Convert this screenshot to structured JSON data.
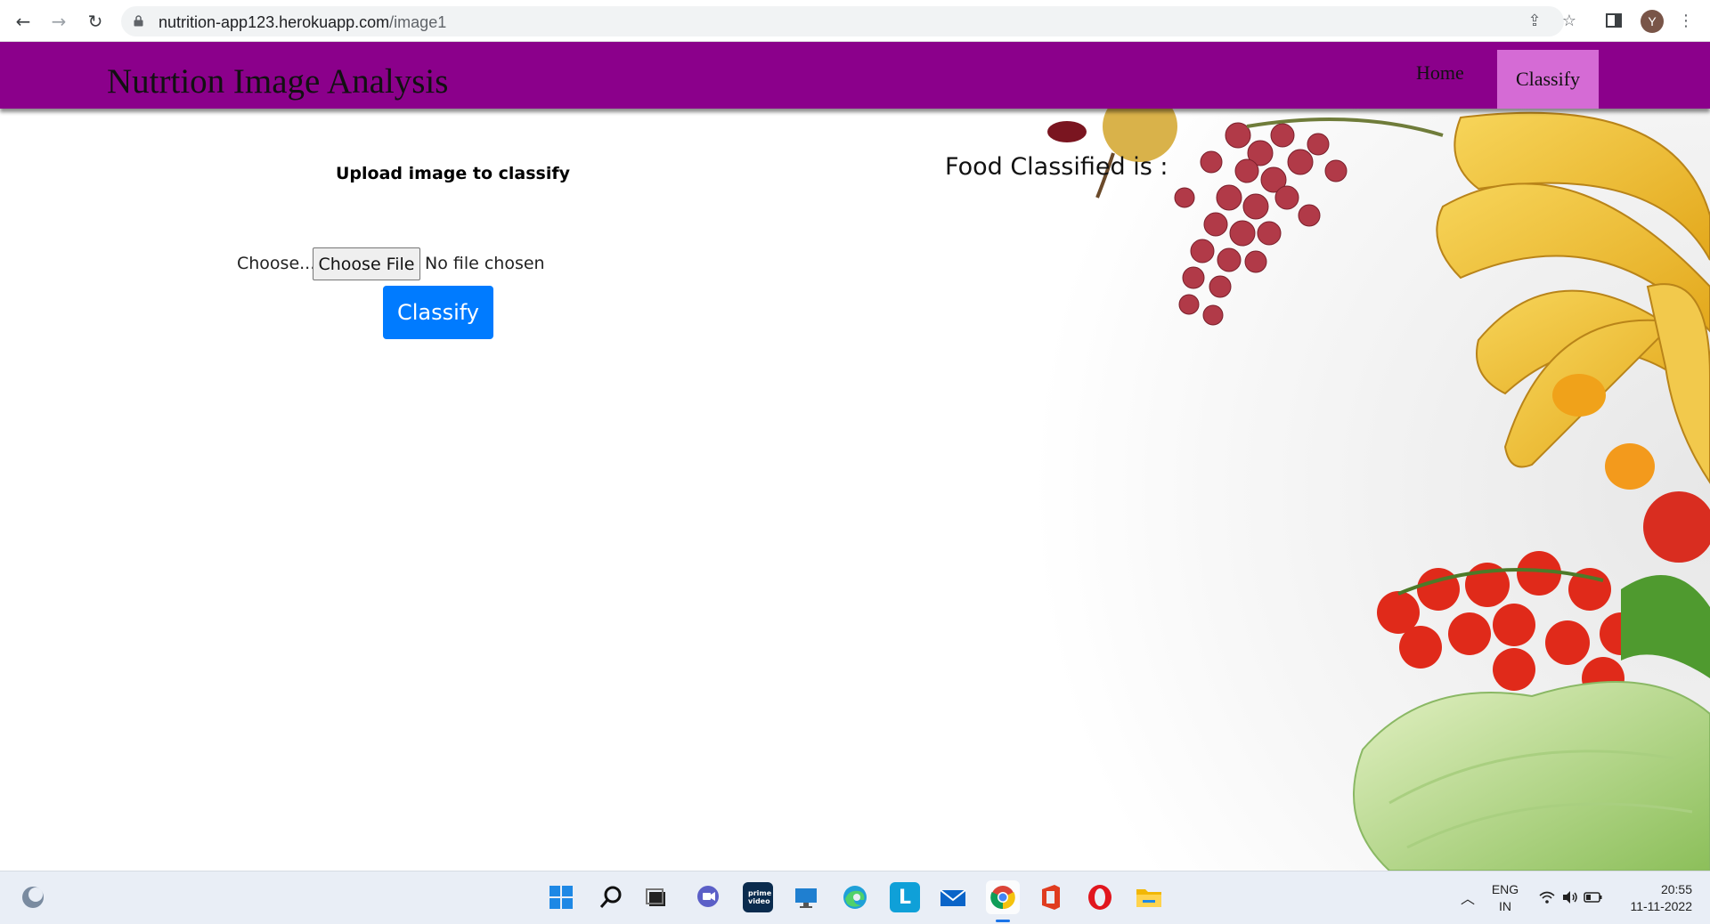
{
  "browser": {
    "url_host": "nutrition-app123.herokuapp.com",
    "url_path": "/image1",
    "profile_initial": "Y"
  },
  "navbar": {
    "brand": "Nutrtion Image Analysis",
    "links": [
      {
        "label": "Home",
        "active": false
      },
      {
        "label": "Classify",
        "active": true
      }
    ],
    "color": "#8b008b",
    "active_color": "#d56bd5"
  },
  "upload": {
    "title": "Upload image to classify",
    "choose_label": "Choose...",
    "file_button": "Choose File",
    "file_status": "No file chosen",
    "submit_label": "Classify",
    "submit_color": "#007bff"
  },
  "result": {
    "title": "Food Classified is :"
  },
  "taskbar": {
    "apps": [
      "widgets-icon",
      "start-icon",
      "search-icon",
      "task-view-icon",
      "teams-chat-icon",
      "prime-video-icon",
      "remote-desktop-icon",
      "edge-icon",
      "l-app-icon",
      "mail-icon",
      "chrome-icon",
      "office-icon",
      "opera-icon",
      "file-explorer-icon"
    ],
    "prime_text": "prime video",
    "l_app_text": "L",
    "lang_top": "ENG",
    "lang_bottom": "IN",
    "time": "20:55",
    "date": "11-11-2022"
  }
}
